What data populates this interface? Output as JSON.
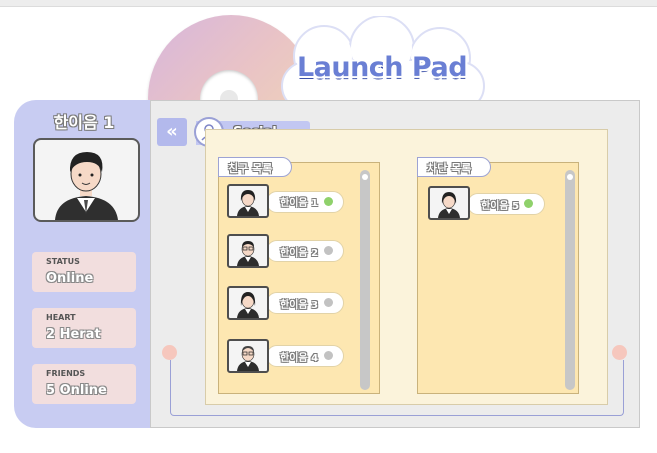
{
  "app": {
    "title": "Launch Pad"
  },
  "profile": {
    "name": "한이음 1",
    "stats": [
      {
        "label": "STATUS",
        "value": "Online"
      },
      {
        "label": "HEART",
        "value": "2 Herat"
      },
      {
        "label": "FRIENDS",
        "value": "5 Online"
      }
    ]
  },
  "nav": {
    "back_icon": "double-chevron-left-icon",
    "section_label": "Social"
  },
  "friends_list": {
    "title": "친구 목록",
    "items": [
      {
        "name": "한이음 1",
        "status": "online"
      },
      {
        "name": "한이음 2",
        "status": "offline"
      },
      {
        "name": "한이음 3",
        "status": "offline"
      },
      {
        "name": "한이음 4",
        "status": "offline"
      }
    ]
  },
  "blocked_list": {
    "title": "차단 목록",
    "items": [
      {
        "name": "한이음 5",
        "status": "online"
      }
    ]
  },
  "colors": {
    "accent": "#6a7fd4",
    "panel": "#c8ccf2",
    "online": "#8fd16b",
    "offline": "#c2c2c2"
  }
}
